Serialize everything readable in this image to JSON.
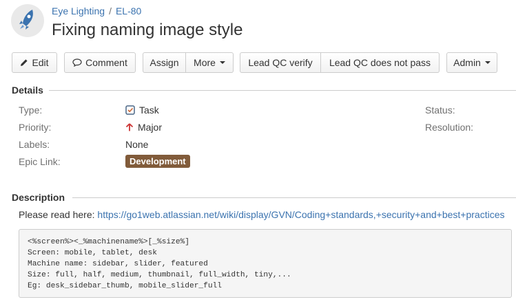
{
  "header": {
    "project_name": "Eye Lighting",
    "separator": "/",
    "issue_key": "EL-80",
    "title": "Fixing naming image style"
  },
  "toolbar": {
    "edit": "Edit",
    "comment": "Comment",
    "assign": "Assign",
    "more": "More",
    "lead_qc_verify": "Lead QC verify",
    "lead_qc_not_pass": "Lead QC does not pass",
    "admin": "Admin"
  },
  "details": {
    "heading": "Details",
    "type_label": "Type:",
    "type_value": "Task",
    "priority_label": "Priority:",
    "priority_value": "Major",
    "labels_label": "Labels:",
    "labels_value": "None",
    "epic_label": "Epic Link:",
    "epic_value": "Development",
    "status_label": "Status:",
    "resolution_label": "Resolution:"
  },
  "description": {
    "heading": "Description",
    "intro": "Please read here:",
    "link": "https://go1web.atlassian.net/wiki/display/GVN/Coding+standards,+security+and+best+practices",
    "code_lines": [
      "<%screen%><_%machinename%>[_%size%]",
      "Screen: mobile, tablet, desk",
      "Machine name: sidebar, slider, featured",
      "Size: full, half, medium, thumbnail, full_width, tiny,...",
      "Eg: desk_sidebar_thumb, mobile_slider_full"
    ]
  },
  "colors": {
    "link": "#3b73af",
    "epic": "#815b3a",
    "priority_major": "#cc3333",
    "task_icon": "#4a6785"
  }
}
